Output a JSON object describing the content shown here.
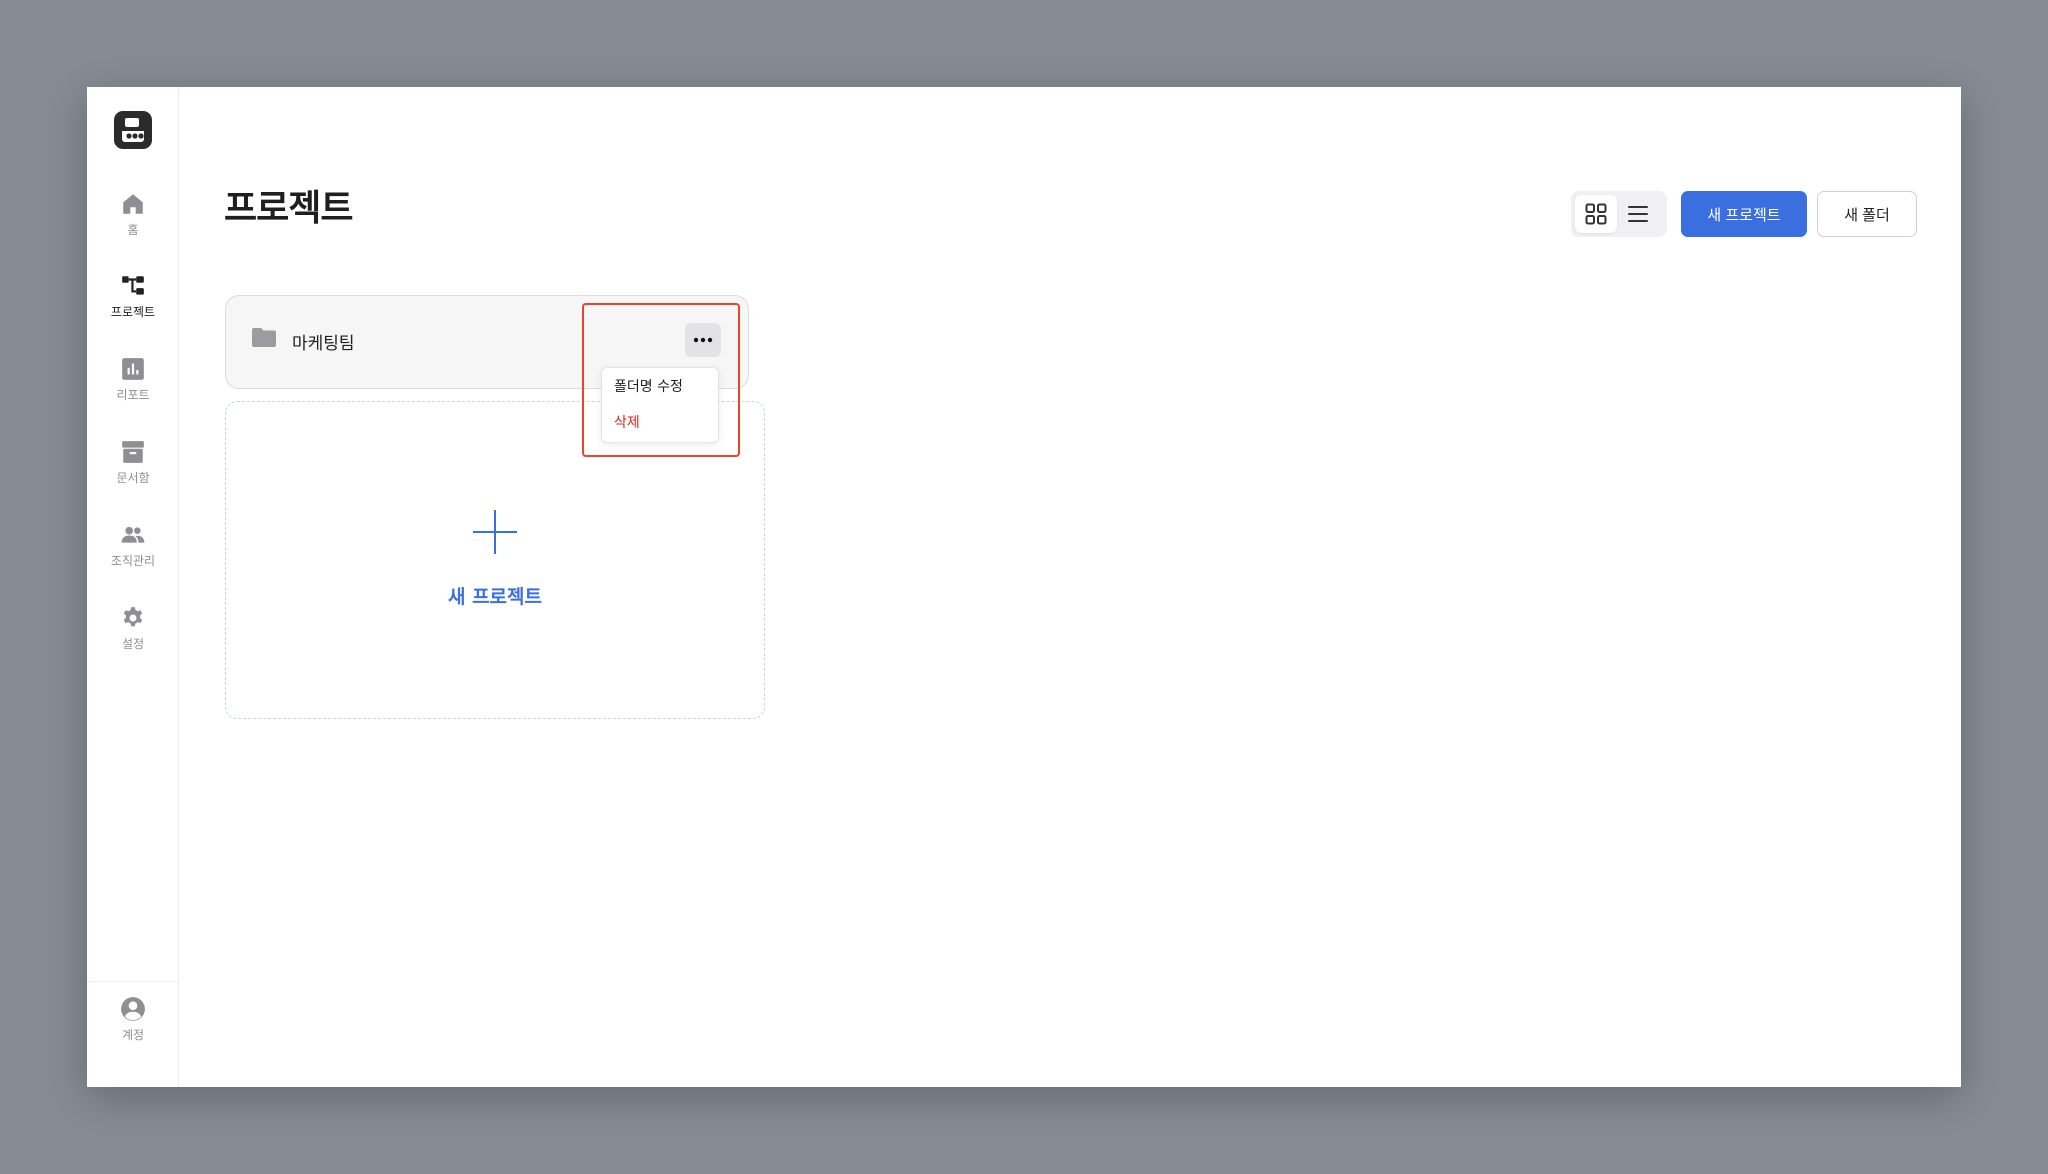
{
  "sidebar": {
    "logo": "app-logo",
    "items": [
      {
        "label": "홈",
        "icon": "home-icon"
      },
      {
        "label": "프로젝트",
        "icon": "project-tree-icon"
      },
      {
        "label": "리포트",
        "icon": "report-chart-icon"
      },
      {
        "label": "문서함",
        "icon": "archive-box-icon"
      },
      {
        "label": "조직관리",
        "icon": "people-icon"
      },
      {
        "label": "설정",
        "icon": "gear-icon"
      }
    ],
    "account": {
      "label": "계정",
      "icon": "account-circle-icon"
    }
  },
  "page": {
    "title": "프로젝트"
  },
  "toolbar": {
    "new_project_label": "새 프로젝트",
    "new_folder_label": "새 폴더",
    "view_mode": "grid"
  },
  "folder": {
    "name": "마케팅팀"
  },
  "folder_menu": {
    "rename_label": "폴더명 수정",
    "delete_label": "삭제"
  },
  "new_project_card": {
    "label": "새 프로젝트"
  },
  "colors": {
    "primary": "#3b6fe0",
    "danger": "#d8261d",
    "highlight": "#e8442e"
  }
}
